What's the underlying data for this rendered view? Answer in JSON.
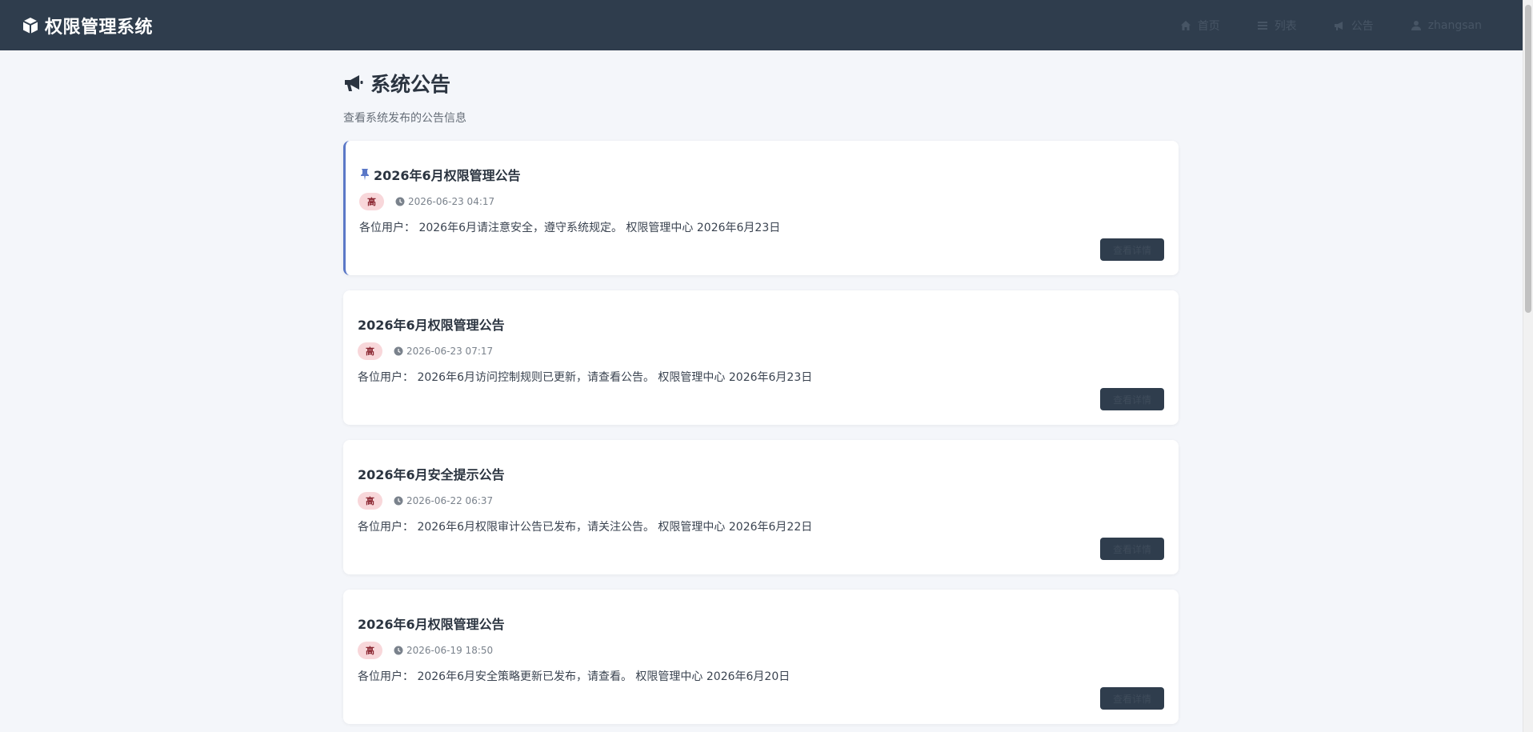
{
  "app": {
    "title": "权限管理系统"
  },
  "nav": {
    "home": "首页",
    "list": "列表",
    "announce": "公告",
    "user": "zhangsan"
  },
  "page": {
    "title": "系统公告",
    "subtitle": "查看系统发布的公告信息"
  },
  "colors": {
    "navbar": "#2f3d4d",
    "accent": "#5b78c7",
    "badge_bg": "#f8d7da",
    "badge_text": "#8a2631",
    "background": "#f4f6fa"
  },
  "announcements": [
    {
      "title": "2026年6月权限管理公告",
      "pinned": true,
      "priority": "高",
      "time": "2026-06-23 04:17",
      "body": "各位用户： 2026年6月请注意安全，遵守系统规定。 权限管理中心 2026年6月23日",
      "button": "查看详情"
    },
    {
      "title": "2026年6月权限管理公告",
      "pinned": false,
      "priority": "高",
      "time": "2026-06-23 07:17",
      "body": "各位用户： 2026年6月访问控制规则已更新，请查看公告。 权限管理中心 2026年6月23日",
      "button": "查看详情"
    },
    {
      "title": "2026年6月安全提示公告",
      "pinned": false,
      "priority": "高",
      "time": "2026-06-22 06:37",
      "body": "各位用户： 2026年6月权限审计公告已发布，请关注公告。 权限管理中心 2026年6月22日",
      "button": "查看详情"
    },
    {
      "title": "2026年6月权限管理公告",
      "pinned": false,
      "priority": "高",
      "time": "2026-06-19 18:50",
      "body": "各位用户： 2026年6月安全策略更新已发布，请查看。 权限管理中心 2026年6月20日",
      "button": "查看详情"
    }
  ]
}
